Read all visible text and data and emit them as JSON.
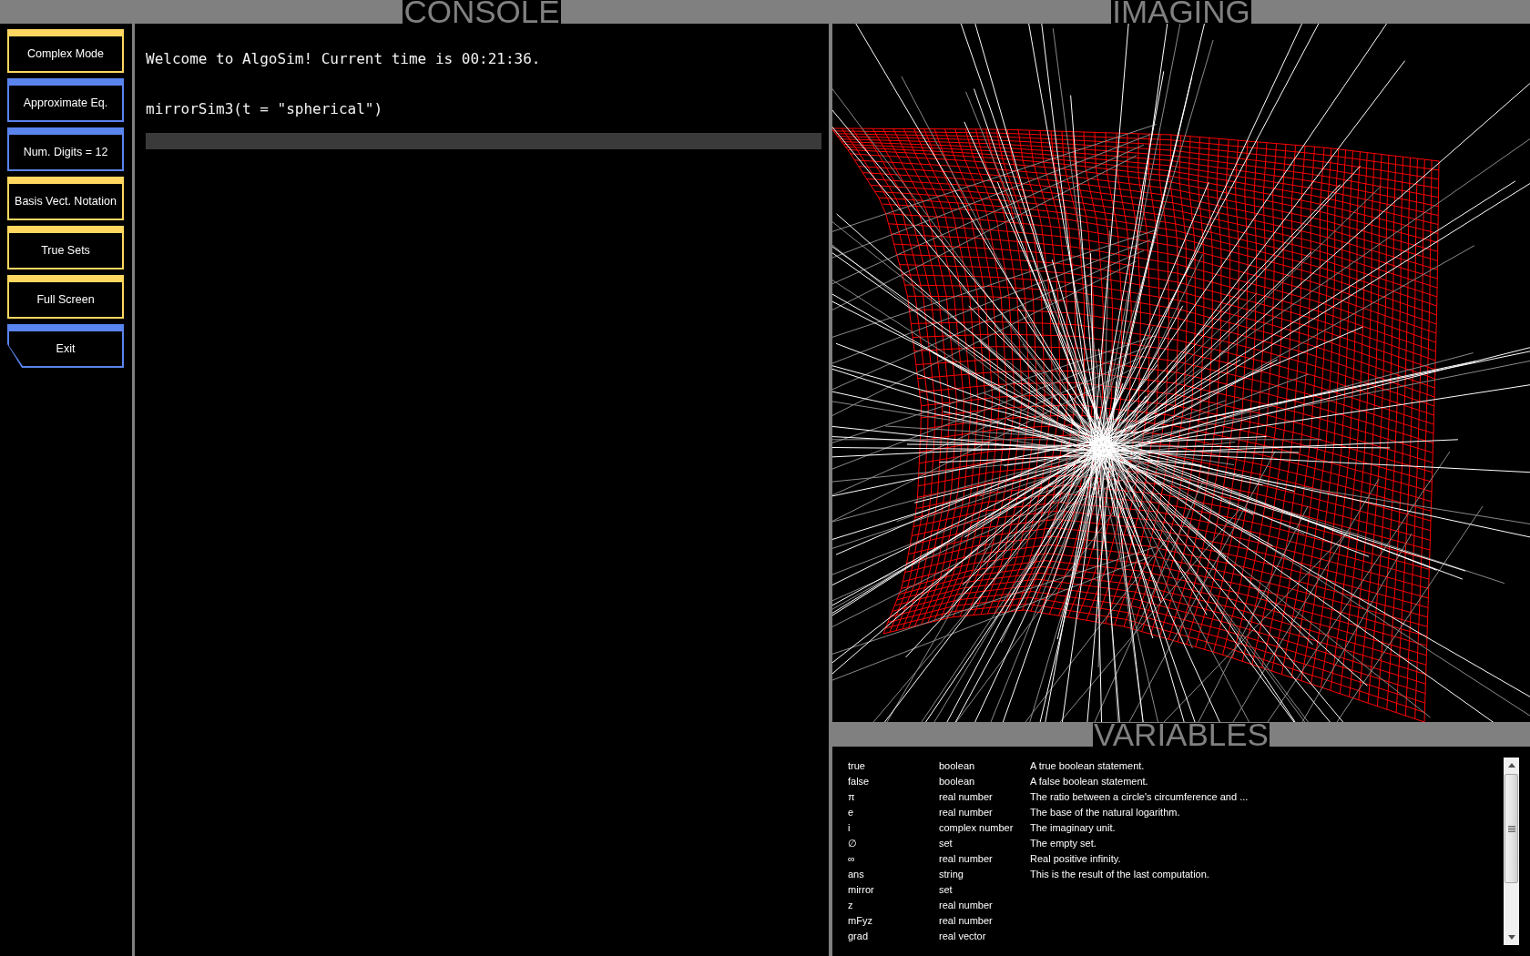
{
  "sidebar": {
    "buttons": [
      {
        "label": "Complex Mode",
        "color": "#ffd760",
        "kind": "square"
      },
      {
        "label": "Approximate Eq.",
        "color": "#5a84ee",
        "kind": "square"
      },
      {
        "label": "Num. Digits = 12",
        "color": "#5a84ee",
        "kind": "square"
      },
      {
        "label": "Basis Vect. Notation",
        "color": "#ffd760",
        "kind": "square"
      },
      {
        "label": "True Sets",
        "color": "#ffd760",
        "kind": "square"
      },
      {
        "label": "Full Screen",
        "color": "#ffd760",
        "kind": "square"
      },
      {
        "label": "Exit",
        "color": "#5a84ee",
        "kind": "notched"
      }
    ]
  },
  "console": {
    "title": "CONSOLE",
    "lines": [
      "Welcome to AlgoSim! Current time is 00:21:36.",
      "mirrorSim3(t = \"spherical\")"
    ]
  },
  "imaging": {
    "title": "IMAGING"
  },
  "variables": {
    "title": "VARIABLES",
    "rows": [
      {
        "name": "true",
        "type": "boolean",
        "description": "A true boolean statement."
      },
      {
        "name": "false",
        "type": "boolean",
        "description": "A false boolean statement."
      },
      {
        "name": "π",
        "type": "real number",
        "description": "The ratio between a circle's circumference and ..."
      },
      {
        "name": "e",
        "type": "real number",
        "description": "The base of the natural logarithm."
      },
      {
        "name": "i",
        "type": "complex number",
        "description": "The imaginary unit."
      },
      {
        "name": "∅",
        "type": "set",
        "description": "The empty set."
      },
      {
        "name": "∞",
        "type": "real number",
        "description": "Real positive infinity."
      },
      {
        "name": "ans",
        "type": "string",
        "description": "This is the result of the last computation."
      },
      {
        "name": "mirror",
        "type": "set"
      },
      {
        "name": "z",
        "type": "real number"
      },
      {
        "name": "mFyz",
        "type": "real number"
      },
      {
        "name": "grad",
        "type": "real vector"
      }
    ]
  }
}
